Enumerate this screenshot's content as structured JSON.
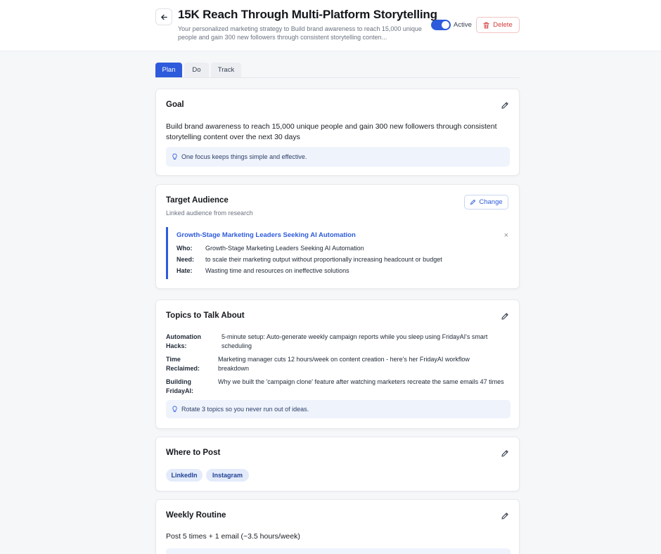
{
  "header": {
    "title": "15K Reach Through Multi-Platform Storytelling",
    "subtitle": "Your personalized marketing strategy to Build brand awareness to reach 15,000 unique people and gain 300 new followers through consistent storytelling conten...",
    "active_label": "Active",
    "active_on": true,
    "delete_label": "Delete"
  },
  "tabs": [
    {
      "label": "Plan",
      "active": true
    },
    {
      "label": "Do",
      "active": false
    },
    {
      "label": "Track",
      "active": false
    }
  ],
  "goal": {
    "title": "Goal",
    "text": "Build brand awareness to reach 15,000 unique people and gain 300 new followers through consistent storytelling content over the next 30 days",
    "hint": "One focus keeps things simple and effective."
  },
  "audience": {
    "title": "Target Audience",
    "subtitle": "Linked audience from research",
    "change_label": "Change",
    "name": "Growth-Stage Marketing Leaders Seeking AI Automation",
    "close_glyph": "×",
    "rows": [
      {
        "key": "Who:",
        "value": "Growth-Stage Marketing Leaders Seeking AI Automation"
      },
      {
        "key": "Need:",
        "value": "to scale their marketing output without proportionally increasing headcount or budget"
      },
      {
        "key": "Hate:",
        "value": "Wasting time and resources on ineffective solutions"
      }
    ]
  },
  "topics": {
    "title": "Topics to Talk About",
    "items": [
      {
        "key": "Automation Hacks:",
        "value": "5-minute setup: Auto-generate weekly campaign reports while you sleep using FridayAI's smart scheduling"
      },
      {
        "key": "Time Reclaimed:",
        "value": "Marketing manager cuts 12 hours/week on content creation - here's her FridayAI workflow breakdown"
      },
      {
        "key": "Building FridayAI:",
        "value": "Why we built the 'campaign clone' feature after watching marketers recreate the same emails 47 times"
      }
    ],
    "hint": "Rotate 3 topics so you never run out of ideas."
  },
  "where": {
    "title": "Where to Post",
    "platforms": [
      "LinkedIn",
      "Instagram"
    ]
  },
  "routine": {
    "title": "Weekly Routine",
    "text": "Post 5 times + 1 email (~3.5 hours/week)"
  },
  "colors": {
    "accent": "#2e5bdb",
    "danger": "#d43b3b",
    "hint_bg": "#eef3fc"
  }
}
